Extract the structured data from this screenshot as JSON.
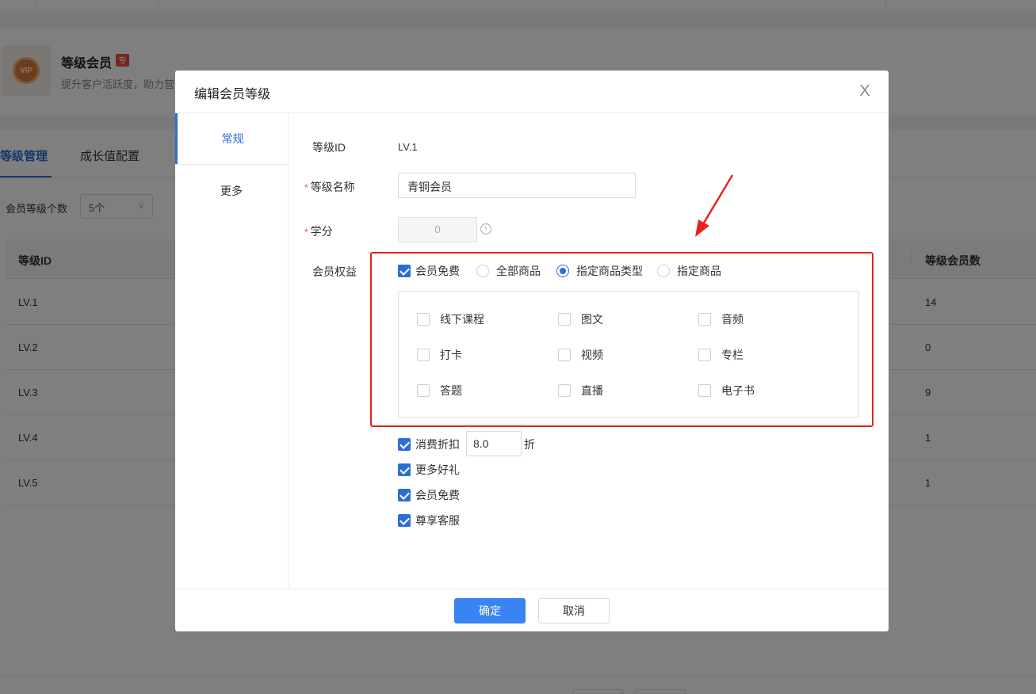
{
  "background": {
    "app_title": "等级会员",
    "app_tag": "专",
    "app_desc": "提升客户活跃度，助力营",
    "tabs": [
      "等级管理",
      "成长值配置"
    ],
    "count_label": "会员等级个数",
    "count_value": "5个",
    "table": {
      "headers": [
        "等级ID",
        "等级会员数"
      ],
      "rows": [
        {
          "id": "LV.1",
          "members": "14"
        },
        {
          "id": "LV.2",
          "members": "0"
        },
        {
          "id": "LV.3",
          "members": "9"
        },
        {
          "id": "LV.4",
          "members": "1"
        },
        {
          "id": "LV.5",
          "members": "1"
        }
      ]
    }
  },
  "modal": {
    "title": "编辑会员等级",
    "close": "X",
    "side_nav": [
      "常规",
      "更多"
    ],
    "fields": {
      "level_id_label": "等级ID",
      "level_id_value": "LV.1",
      "name_label": "等级名称",
      "name_value": "青铜会员",
      "credit_label": "学分",
      "credit_value": "0",
      "rights_label": "会员权益",
      "required_mark": "*"
    },
    "rights_row": {
      "free_label": "会员免费",
      "free_checked": true,
      "scope_options": [
        {
          "label": "全部商品",
          "selected": false
        },
        {
          "label": "指定商品类型",
          "selected": true
        },
        {
          "label": "指定商品",
          "selected": false
        }
      ]
    },
    "product_types": [
      {
        "label": "线下课程",
        "checked": false
      },
      {
        "label": "图文",
        "checked": false
      },
      {
        "label": "音频",
        "checked": false
      },
      {
        "label": "打卡",
        "checked": false
      },
      {
        "label": "视频",
        "checked": false
      },
      {
        "label": "专栏",
        "checked": false
      },
      {
        "label": "答题",
        "checked": false
      },
      {
        "label": "直播",
        "checked": false
      },
      {
        "label": "电子书",
        "checked": false
      }
    ],
    "extra_rights": [
      {
        "label": "消费折扣",
        "checked": true
      },
      {
        "label": "更多好礼",
        "checked": true
      },
      {
        "label": "会员免费",
        "checked": true
      },
      {
        "label": "尊享客服",
        "checked": true
      }
    ],
    "discount_value": "8.0",
    "discount_unit": "折",
    "confirm_label": "确定",
    "cancel_label": "取消",
    "info_icon": "i"
  },
  "colors": {
    "accent": "#2b6fd6",
    "primary_button": "#3a83f2",
    "annotation_red": "#e8231c"
  }
}
